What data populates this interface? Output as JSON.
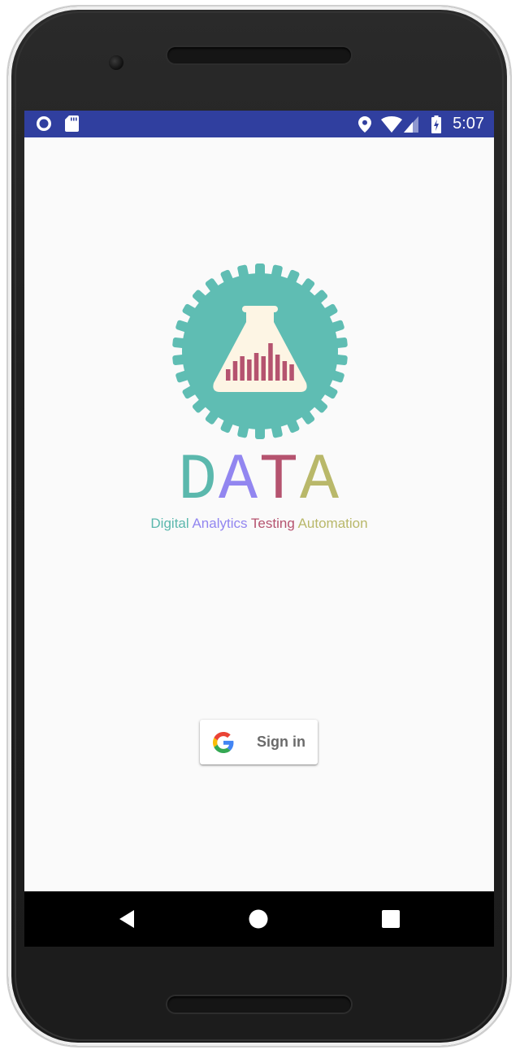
{
  "status_bar": {
    "time": "5:07",
    "icons": [
      "circle-notification-icon",
      "sd-card-icon",
      "location-icon",
      "wifi-icon",
      "cell-signal-icon",
      "battery-charging-icon"
    ],
    "background_color": "#303f9f"
  },
  "app": {
    "logo_icon": "flask-gear-logo",
    "brand_letters": [
      {
        "char": "D",
        "color": "#5bb8ad"
      },
      {
        "char": "A",
        "color": "#9286f0"
      },
      {
        "char": "T",
        "color": "#b5536f"
      },
      {
        "char": "A",
        "color": "#b9b86a"
      }
    ],
    "tagline_words": [
      {
        "text": "Digital",
        "color": "#5bb8ad"
      },
      {
        "text": "Analytics",
        "color": "#9286f0"
      },
      {
        "text": "Testing",
        "color": "#b5536f"
      },
      {
        "text": "Automation",
        "color": "#b9b86a"
      }
    ]
  },
  "signin": {
    "label": "Sign in",
    "icon": "google-g-icon"
  },
  "nav_bar": {
    "buttons": [
      "back-icon",
      "home-icon",
      "recents-icon"
    ]
  }
}
